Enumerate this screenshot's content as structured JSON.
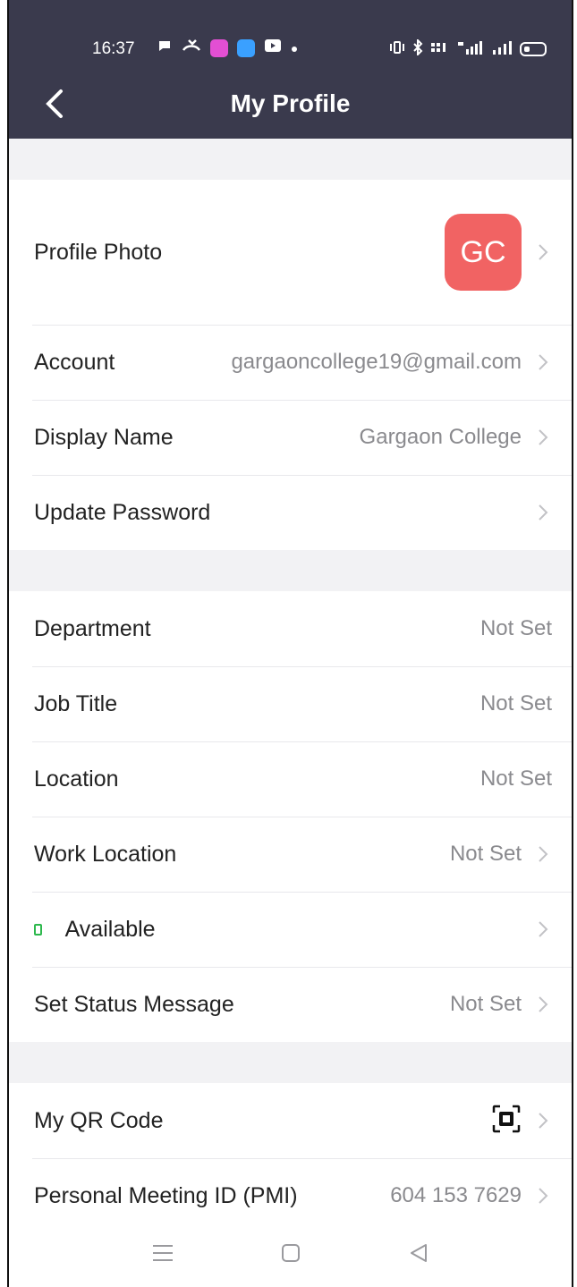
{
  "status_bar": {
    "time": "16:37"
  },
  "header": {
    "title": "My Profile"
  },
  "profile": {
    "photo_label": "Profile Photo",
    "avatar_initials": "GC",
    "avatar_color": "#f16363",
    "account_label": "Account",
    "account_value": "gargaoncollege19@gmail.com",
    "display_name_label": "Display Name",
    "display_name_value": "Gargaon College",
    "update_password_label": "Update Password"
  },
  "work": {
    "department_label": "Department",
    "department_value": "Not Set",
    "job_title_label": "Job Title",
    "job_title_value": "Not Set",
    "location_label": "Location",
    "location_value": "Not Set",
    "work_location_label": "Work Location",
    "work_location_value": "Not Set",
    "availability_label": "Available",
    "availability_color": "#2db84d",
    "status_message_label": "Set Status Message",
    "status_message_value": "Not Set"
  },
  "meeting": {
    "qr_label": "My QR Code",
    "pmi_label": "Personal Meeting ID (PMI)",
    "pmi_value": "604 153 7629"
  },
  "colors": {
    "header_bg": "#3a3a4d",
    "section_gap": "#f2f2f4"
  }
}
